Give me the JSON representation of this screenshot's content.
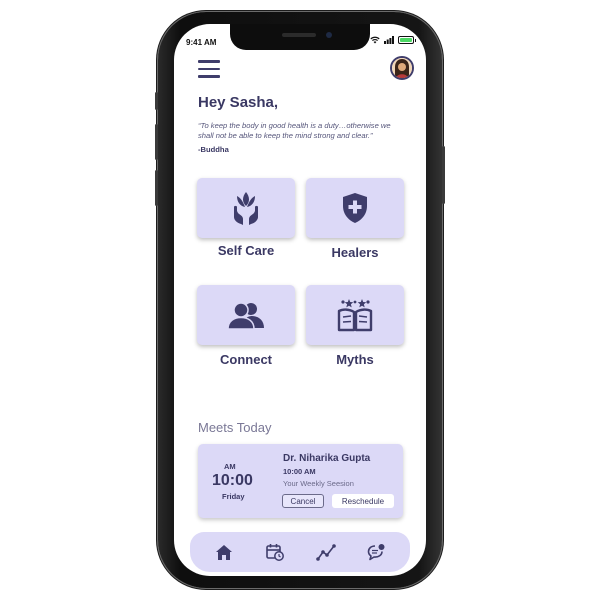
{
  "status_bar": {
    "time": "9:41 AM"
  },
  "header": {
    "greeting": "Hey Sasha,"
  },
  "quote": {
    "text": "“To keep the body in good health is a duty…otherwise we shall not be able to keep the mind strong and clear.”",
    "author": "-Buddha"
  },
  "tiles": [
    {
      "label": "Self Care",
      "icon": "lotus-hands-icon"
    },
    {
      "label": "Healers",
      "icon": "medical-shield-icon"
    },
    {
      "label": "Connect",
      "icon": "people-icon"
    },
    {
      "label": "Myths",
      "icon": "open-book-stars-icon"
    }
  ],
  "meets": {
    "title": "Meets Today",
    "card": {
      "ampm": "AM",
      "time": "10:00",
      "day": "Friday",
      "doctor": "Dr. Niharika Gupta",
      "session_time": "10:00 AM",
      "description": "Your Weekly Seesion",
      "cancel_label": "Cancel",
      "reschedule_label": "Reschedule"
    }
  },
  "tabbar": {
    "items": [
      "home-icon",
      "calendar-clock-icon",
      "progress-chart-icon",
      "chat-bubble-icon"
    ]
  },
  "colors": {
    "accent": "#3f3d6b",
    "tile_bg": "#dcd9f7",
    "battery": "#4cd964"
  }
}
